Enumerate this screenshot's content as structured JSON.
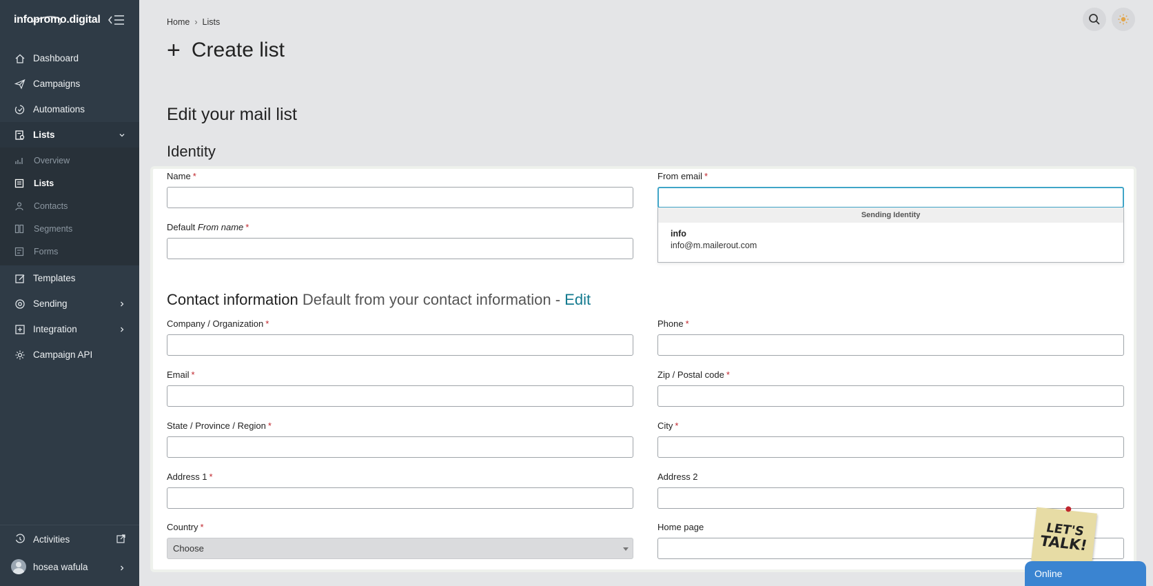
{
  "app": {
    "logo_text": "infopromo.digital"
  },
  "sidebar": {
    "items": [
      {
        "label": "Dashboard",
        "icon": "home-icon"
      },
      {
        "label": "Campaigns",
        "icon": "paper-plane-icon"
      },
      {
        "label": "Automations",
        "icon": "automation-icon"
      },
      {
        "label": "Lists",
        "icon": "list-icon"
      },
      {
        "label": "Templates",
        "icon": "template-icon"
      },
      {
        "label": "Sending",
        "icon": "sending-icon"
      },
      {
        "label": "Integration",
        "icon": "integration-icon"
      },
      {
        "label": "Campaign API",
        "icon": "gear-icon"
      }
    ],
    "lists_sub": [
      {
        "label": "Overview",
        "icon": "chart-icon"
      },
      {
        "label": "Lists",
        "icon": "list-icon"
      },
      {
        "label": "Contacts",
        "icon": "contact-icon"
      },
      {
        "label": "Segments",
        "icon": "segment-icon"
      },
      {
        "label": "Forms",
        "icon": "form-icon"
      }
    ],
    "activities_label": "Activities",
    "user_name": "hosea wafula"
  },
  "breadcrumb": {
    "home": "Home",
    "current": "Lists"
  },
  "page": {
    "title": "Create list",
    "section_title": "Edit your mail list",
    "identity_title": "Identity"
  },
  "identity": {
    "name_label": "Name",
    "from_name_label_prefix": "Default",
    "from_name_label_em": "From name",
    "from_email_label": "From email",
    "required_mark": "*",
    "dropdown": {
      "header": "Sending Identity",
      "option_name": "info",
      "option_email": "info@m.mailerout.com"
    }
  },
  "contact": {
    "title": "Contact information",
    "subtitle": "Default from your contact information -",
    "edit_link": "Edit",
    "company_label": "Company / Organization",
    "phone_label": "Phone",
    "email_label": "Email",
    "zip_label": "Zip / Postal code",
    "state_label": "State / Province / Region",
    "city_label": "City",
    "address1_label": "Address 1",
    "address2_label": "Address 2",
    "country_label": "Country",
    "country_value": "Choose",
    "homepage_label": "Home page"
  },
  "widget": {
    "sticker_line1": "LET'S",
    "sticker_line2": "TALK!",
    "online_label": "Online"
  }
}
